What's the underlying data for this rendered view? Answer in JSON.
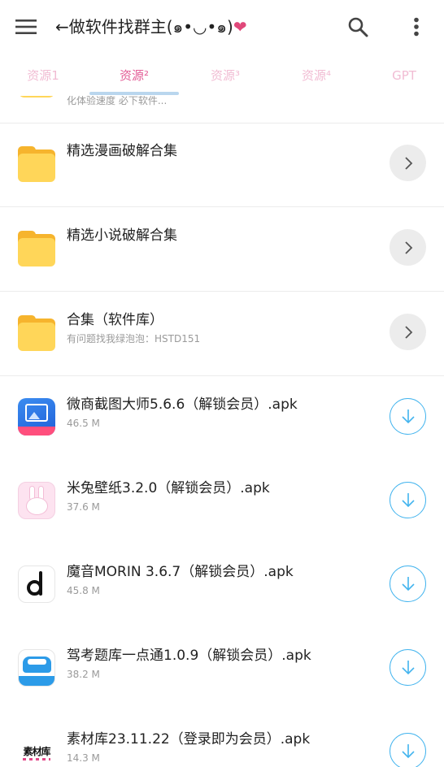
{
  "appbar": {
    "title": "←做软件找群主(๑•◡•๑)",
    "title_heart": "❤"
  },
  "tabs": [
    {
      "label": "资源1",
      "active": false
    },
    {
      "label": "资源²",
      "active": true
    },
    {
      "label": "资源³",
      "active": false
    },
    {
      "label": "资源⁴",
      "active": false
    },
    {
      "label": "GPT",
      "active": false
    }
  ],
  "partial_row": {
    "subtitle": "化体验速度 必下软件..."
  },
  "folders": [
    {
      "title": "精选漫画破解合集",
      "subtitle": ""
    },
    {
      "title": "精选小说破解合集",
      "subtitle": ""
    },
    {
      "title": "合集（软件库）",
      "subtitle": "有问题找我绿泡泡：HSTD151"
    }
  ],
  "files": [
    {
      "title": "微商截图大师5.6.6（解锁会员）.apk",
      "size": "46.5 M",
      "icon": "weishang-app-icon"
    },
    {
      "title": "米兔壁纸3.2.0（解锁会员）.apk",
      "size": "37.6 M",
      "icon": "mitu-app-icon"
    },
    {
      "title": "魔音MORIN 3.6.7（解锁会员）.apk",
      "size": "45.8 M",
      "icon": "morin-app-icon"
    },
    {
      "title": "驾考题库一点通1.0.9（解锁会员）.apk",
      "size": "38.2 M",
      "icon": "jiakao-app-icon"
    },
    {
      "title": "素材库23.11.22（登录即为会员）.apk",
      "size": "14.3 M",
      "icon": "sucai-app-icon",
      "icon_text": "素材库"
    }
  ],
  "colors": {
    "accent_pink": "#e35d96",
    "tab_inactive": "#f1bcd3",
    "indicator": "#b9d6ee",
    "download_blue": "#43b4ee",
    "folder_yellow": "#ffd659"
  }
}
